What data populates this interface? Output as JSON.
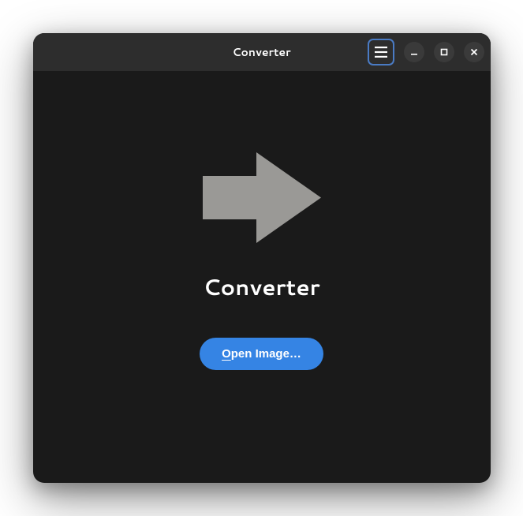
{
  "header": {
    "title": "Converter"
  },
  "main": {
    "icon": "arrow-right-icon",
    "app_name": "Converter",
    "open_button_prefix": "O",
    "open_button_rest": "pen Image…"
  },
  "colors": {
    "accent": "#3584e4",
    "window_bg": "#1a1a1a",
    "titlebar_bg": "#2d2d2d",
    "icon_fill": "#9a9996"
  }
}
